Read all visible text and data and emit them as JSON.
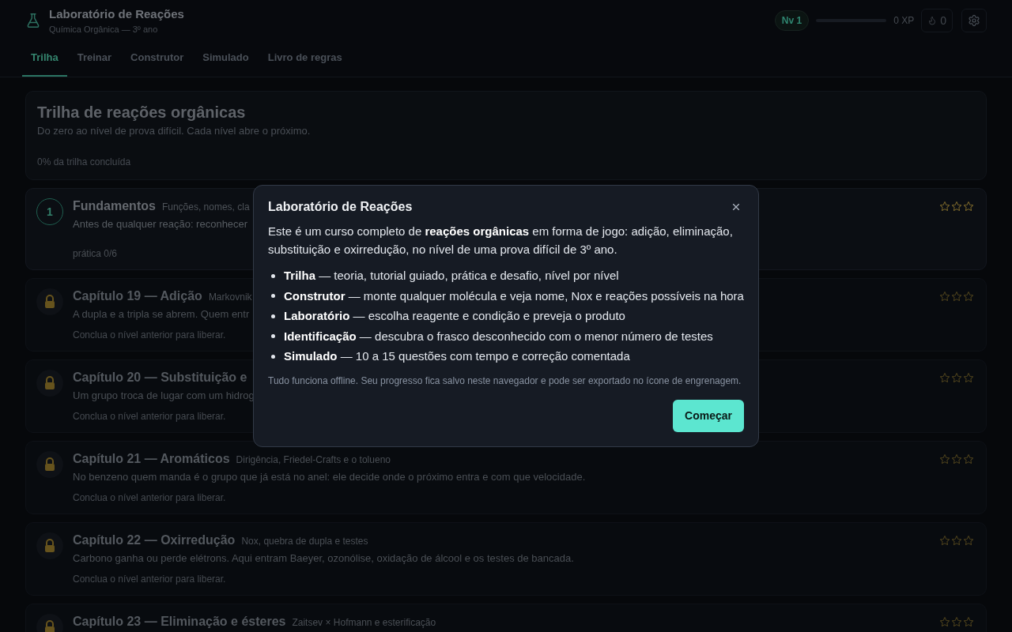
{
  "header": {
    "title": "Laboratório de Reações",
    "subtitle": "Química Orgânica — 3º ano",
    "level_badge": "Nv 1",
    "xp": {
      "level": 0,
      "reading": "0 XP"
    },
    "streak": "0"
  },
  "tabs": [
    {
      "label": "Trilha",
      "selected": true
    },
    {
      "label": "Treinar",
      "selected": false
    },
    {
      "label": "Construtor",
      "selected": false
    },
    {
      "label": "Simulado",
      "selected": false
    },
    {
      "label": "Livro de regras",
      "selected": false
    }
  ],
  "trail": {
    "title": "Trilha de reações orgânicas",
    "subtitle": "Do zero ao nível de prova difícil. Cada nível abre o próximo.",
    "progress_text": "0% da trilha concluída"
  },
  "levels": [
    {
      "kind": "open",
      "number": "1",
      "title": "Fundamentos",
      "subtitle": "Funções, nomes, cla",
      "description": "Antes de qualquer reação: reconhecer",
      "footer": "prática 0/6",
      "stars": 0
    },
    {
      "kind": "locked",
      "title": "Capítulo 19 — Adição",
      "subtitle": "Markovnik",
      "description": "A dupla e a tripla se abrem. Quem entr",
      "footer": "Conclua o nível anterior para liberar.",
      "stars": 0
    },
    {
      "kind": "locked",
      "title": "Capítulo 20 — Substituição e",
      "description": "Um grupo troca de lugar com um hidrog",
      "footer": "Conclua o nível anterior para liberar.",
      "stars": 0
    },
    {
      "kind": "locked",
      "title": "Capítulo 21 — Aromáticos",
      "subtitle": "Dirigência, Friedel-Crafts e o tolueno",
      "description": "No benzeno quem manda é o grupo que já está no anel: ele decide onde o próximo entra e com que velocidade.",
      "footer": "Conclua o nível anterior para liberar.",
      "stars": 0
    },
    {
      "kind": "locked",
      "title": "Capítulo 22 — Oxirredução",
      "subtitle": "Nox, quebra de dupla e testes",
      "description": "Carbono ganha ou perde elétrons. Aqui entram Baeyer, ozonólise, oxidação de álcool e os testes de bancada.",
      "footer": "Conclua o nível anterior para liberar.",
      "stars": 0
    },
    {
      "kind": "locked",
      "title": "Capítulo 23 — Eliminação e ésteres",
      "subtitle": "Zaitsev × Hofmann e esterificação",
      "stars": 0
    }
  ],
  "dialog": {
    "title": "Laboratório de Reações",
    "intro": "Este é um curso completo de **reações orgânicas** em forma de jogo: adição, eliminação, substituição e oxirredução, no nível de uma prova difícil de 3º ano.",
    "features": [
      "**Trilha** — teoria, tutorial guiado, prática e desafio, nível por nível",
      "**Construtor** — monte qualquer molécula e veja nome, Nox e reações possíveis na hora",
      "**Laboratório** — escolha reagente e condição e preveja o produto",
      "**Identificação** — descubra o frasco desconhecido com o menor número de testes",
      "**Simulado** — 10 a 15 questões com tempo e correção comentada"
    ],
    "note": "Tudo funciona offline. Seu progresso fica salvo neste navegador e pode ser exportado no ícone de engrenagem.",
    "button": "Começar"
  }
}
